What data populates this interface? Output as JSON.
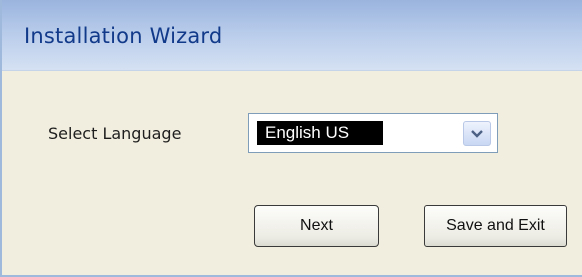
{
  "window": {
    "title": "Installation Wizard"
  },
  "language": {
    "label": "Select Language",
    "selected_value": "English US",
    "dropdown_icon": "chevron-down-icon"
  },
  "buttons": {
    "next_label": "Next",
    "save_exit_label": "Save and Exit"
  },
  "colors": {
    "title_text": "#123a8a",
    "title_bar": "#b7cbea",
    "window_background": "#f1eedf",
    "selection_highlight": "#000000"
  }
}
